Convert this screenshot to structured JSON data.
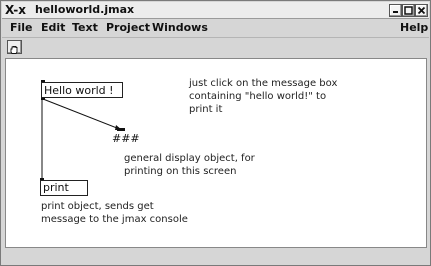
{
  "window": {
    "title": "helloworld.jmax",
    "x_logo": "X-x"
  },
  "menubar": {
    "items": [
      "File",
      "Edit",
      "Text",
      "Project",
      "Windows"
    ],
    "help": "Help"
  },
  "patch": {
    "message_box": "Hello world !",
    "display_object": "###",
    "print_object": "print",
    "comment_click": "just click on the message box\ncontaining \"hello world!\" to\nprint it",
    "comment_display": "general display object, for\nprinting on this screen",
    "comment_print": "print object, sends get\nmessage to the jmax console"
  },
  "colors": {
    "titlebar": "#ececec",
    "chrome": "#d6d6d6",
    "canvas": "#ffffff"
  }
}
